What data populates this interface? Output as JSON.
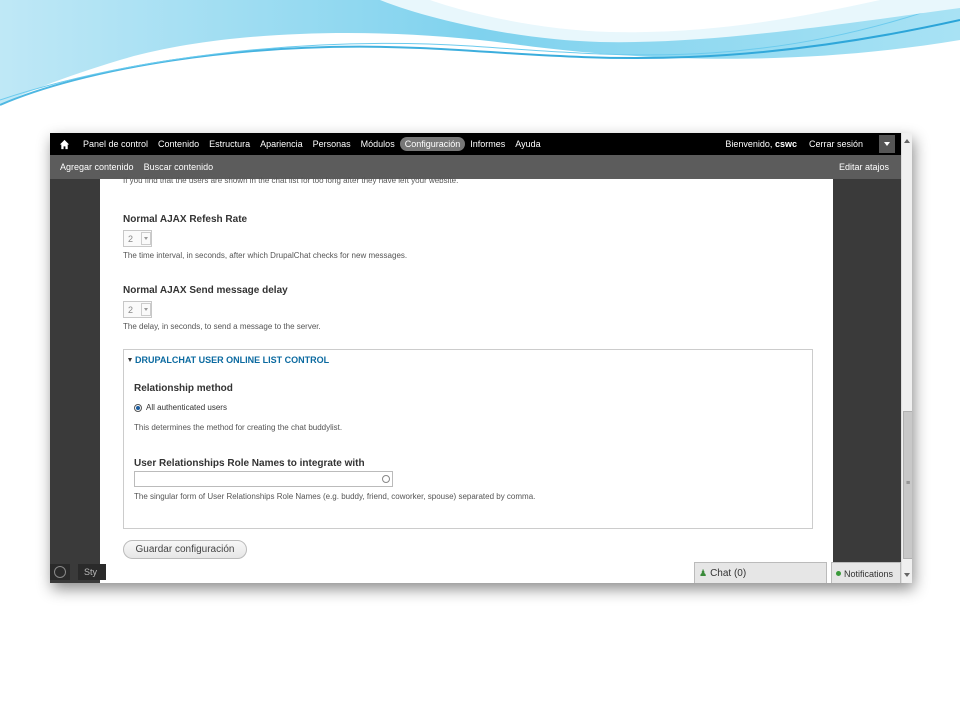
{
  "toolbar": {
    "items": [
      "Panel de control",
      "Contenido",
      "Estructura",
      "Apariencia",
      "Personas",
      "Módulos",
      "Configuración",
      "Informes",
      "Ayuda"
    ],
    "active": "Configuración",
    "welcome_prefix": "Bienvenido,",
    "username": "cswc",
    "logout": "Cerrar sesión"
  },
  "shortcuts": {
    "items": [
      "Agregar contenido",
      "Buscar contenido"
    ],
    "edit": "Editar atajos"
  },
  "content": {
    "top_cut_text": "If you find that the users are shown in the chat list for too long after they have left your website.",
    "refresh": {
      "label": "Normal AJAX Refesh Rate",
      "value": "2",
      "description": "The time interval, in seconds, after which DrupalChat checks for new messages."
    },
    "send_delay": {
      "label": "Normal AJAX Send message delay",
      "value": "2",
      "description": "The delay, in seconds, to send a message to the server."
    },
    "fieldset": {
      "legend": "DRUPALCHAT USER ONLINE LIST CONTROL",
      "relationship_label": "Relationship method",
      "radio_label": "All authenticated users",
      "relationship_desc": "This determines the method for creating the chat buddylist.",
      "ur_label": "User Relationships Role Names to integrate with",
      "ur_value": "",
      "ur_desc": "The singular form of User Relationships Role Names (e.g. buddy, friend, coworker, spouse) separated by comma."
    },
    "save_button": "Guardar configuración"
  },
  "bottom": {
    "style_label": "Sty",
    "chat_label": "Chat (0)",
    "notifications_label": "Notifications"
  },
  "colors": {
    "toolbar_bg": "#000000",
    "shortcut_bg": "#5c5c5c",
    "legend_link": "#0b6aa0",
    "swoosh": "#5bc4e8"
  }
}
